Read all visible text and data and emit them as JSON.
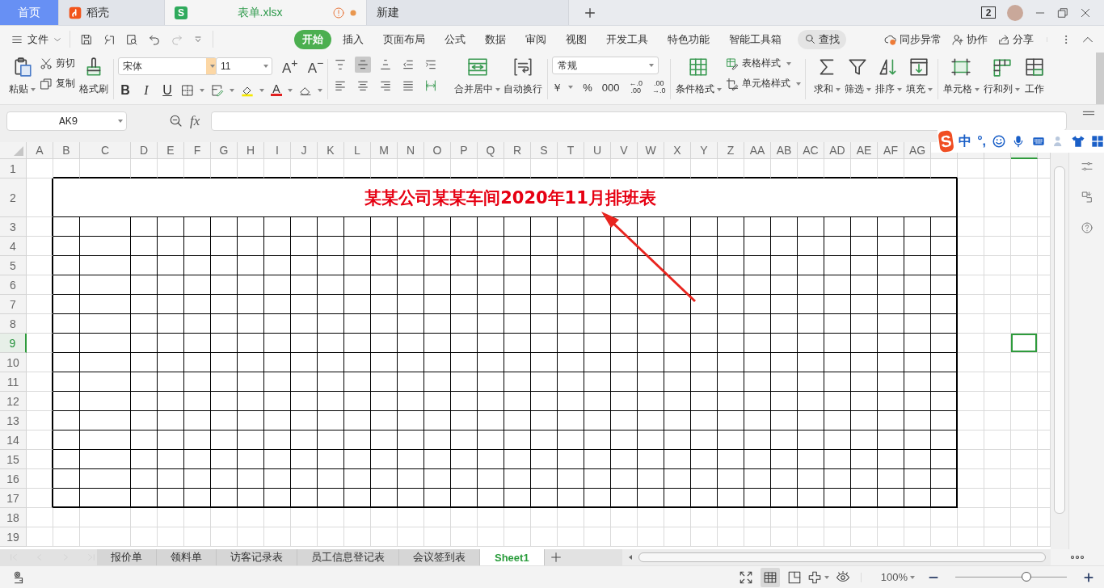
{
  "title_bar": {
    "tabs": [
      {
        "kind": "home",
        "label": "首页",
        "selected": false
      },
      {
        "kind": "app",
        "label": "稻壳",
        "selected": false
      },
      {
        "kind": "doc",
        "badge": "S",
        "label": "表单.xlsx",
        "selected": true,
        "warning": true,
        "modified": true
      },
      {
        "kind": "plain",
        "label": "新建",
        "selected": false
      }
    ],
    "window_count": "2"
  },
  "menu_bar": {
    "file": "文件",
    "tabs": [
      {
        "label": "开始",
        "selected": true
      },
      {
        "label": "插入",
        "selected": false
      },
      {
        "label": "页面布局",
        "selected": false
      },
      {
        "label": "公式",
        "selected": false
      },
      {
        "label": "数据",
        "selected": false
      },
      {
        "label": "审阅",
        "selected": false
      },
      {
        "label": "视图",
        "selected": false
      },
      {
        "label": "开发工具",
        "selected": false
      },
      {
        "label": "特色功能",
        "selected": false
      },
      {
        "label": "智能工具箱",
        "selected": false
      }
    ],
    "search": "查找",
    "actions": [
      {
        "kind": "sync",
        "label": "同步异常"
      },
      {
        "kind": "collab",
        "label": "协作"
      },
      {
        "kind": "share",
        "label": "分享"
      }
    ]
  },
  "ribbon": {
    "clipboard": [
      {
        "kind": "paste",
        "label": "粘贴"
      },
      {
        "kind": "cut",
        "label": "剪切"
      },
      {
        "kind": "copy",
        "label": "复制"
      },
      {
        "kind": "format_painter",
        "label": "格式刷"
      }
    ],
    "font": {
      "name": "宋体",
      "size": "11",
      "size_buttons": [
        "A$^{+}$",
        "A$^{−}$"
      ],
      "styles": [
        {
          "kind": "bold",
          "label": "B"
        },
        {
          "kind": "italic",
          "label": "I"
        },
        {
          "kind": "underline",
          "label": "U"
        }
      ],
      "font_color_label": "A"
    },
    "align_buttons": [
      {
        "kind": "top",
        "selected": false
      },
      {
        "kind": "middle",
        "selected": true
      },
      {
        "kind": "bottom",
        "selected": false
      },
      {
        "kind": "outdent",
        "selected": false
      },
      {
        "kind": "indent",
        "selected": false
      },
      {
        "kind": "left",
        "selected": false
      },
      {
        "kind": "center",
        "selected": false
      },
      {
        "kind": "right",
        "selected": false
      },
      {
        "kind": "justify",
        "selected": false
      },
      {
        "kind": "distributed",
        "selected": false
      }
    ],
    "align": [
      {
        "kind": "merge",
        "label": "合并居中"
      },
      {
        "kind": "wrap",
        "label": "自动换行"
      }
    ],
    "number_format": "常规",
    "number_buttons": [
      {
        "kind": "currency",
        "lines": [
          "￥"
        ]
      },
      {
        "kind": "percent",
        "lines": [
          "%"
        ]
      },
      {
        "kind": "thousands",
        "lines": [
          "000"
        ]
      },
      {
        "kind": "dec_add",
        "lines": [
          "←.0",
          ".00"
        ]
      },
      {
        "kind": "dec_remove",
        "lines": [
          ".00",
          "→.0"
        ]
      }
    ],
    "styles": [
      {
        "kind": "conditional",
        "label": "条件格式"
      },
      {
        "kind": "table_style",
        "label": "表格样式"
      },
      {
        "kind": "cell_style",
        "label": "单元格样式"
      }
    ],
    "editing": [
      {
        "kind": "sum",
        "label": "求和"
      },
      {
        "kind": "filter",
        "label": "筛选"
      },
      {
        "kind": "sort",
        "label": "排序"
      },
      {
        "kind": "fill",
        "label": "填充"
      },
      {
        "kind": "cell",
        "label": "单元格"
      },
      {
        "kind": "rowcol",
        "label": "行和列"
      },
      {
        "kind": "sheet",
        "label": "工作"
      }
    ]
  },
  "formula_bar": {
    "name_box": "AK9",
    "fx": "fx"
  },
  "ime_toolbar": {
    "logo": "S",
    "mode": "中",
    "punctuation": "°,"
  },
  "sheet": {
    "title": "某某公司某某车间2020年11月排班表",
    "columns": [
      {
        "label": "A",
        "selected": false
      },
      {
        "label": "B",
        "selected": false
      },
      {
        "label": "C",
        "selected": false
      },
      {
        "label": "D",
        "selected": false
      },
      {
        "label": "E",
        "selected": false
      },
      {
        "label": "F",
        "selected": false
      },
      {
        "label": "G",
        "selected": false
      },
      {
        "label": "H",
        "selected": false
      },
      {
        "label": "I",
        "selected": false
      },
      {
        "label": "J",
        "selected": false
      },
      {
        "label": "K",
        "selected": false
      },
      {
        "label": "L",
        "selected": false
      },
      {
        "label": "M",
        "selected": false
      },
      {
        "label": "N",
        "selected": false
      },
      {
        "label": "O",
        "selected": false
      },
      {
        "label": "P",
        "selected": false
      },
      {
        "label": "Q",
        "selected": false
      },
      {
        "label": "R",
        "selected": false
      },
      {
        "label": "S",
        "selected": false
      },
      {
        "label": "T",
        "selected": false
      },
      {
        "label": "U",
        "selected": false
      },
      {
        "label": "V",
        "selected": false
      },
      {
        "label": "W",
        "selected": false
      },
      {
        "label": "X",
        "selected": false
      },
      {
        "label": "Y",
        "selected": false
      },
      {
        "label": "Z",
        "selected": false
      },
      {
        "label": "AA",
        "selected": false
      },
      {
        "label": "AB",
        "selected": false
      },
      {
        "label": "AC",
        "selected": false
      },
      {
        "label": "AD",
        "selected": false
      },
      {
        "label": "AE",
        "selected": false
      },
      {
        "label": "AF",
        "selected": false
      },
      {
        "label": "AG",
        "selected": false
      },
      {
        "selected": false
      },
      {
        "selected": false
      },
      {
        "selected": false
      },
      {
        "selected": true
      },
      {
        "selected": false
      }
    ],
    "rows": [
      {
        "label": "1",
        "selected": false
      },
      {
        "label": "2",
        "selected": false
      },
      {
        "label": "3",
        "selected": false
      },
      {
        "label": "4",
        "selected": false
      },
      {
        "label": "5",
        "selected": false
      },
      {
        "label": "6",
        "selected": false
      },
      {
        "label": "7",
        "selected": false
      },
      {
        "label": "8",
        "selected": false
      },
      {
        "label": "9",
        "selected": true
      },
      {
        "label": "10",
        "selected": false
      },
      {
        "label": "11",
        "selected": false
      },
      {
        "label": "12",
        "selected": false
      },
      {
        "label": "13",
        "selected": false
      },
      {
        "label": "14",
        "selected": false
      },
      {
        "label": "15",
        "selected": false
      },
      {
        "label": "16",
        "selected": false
      },
      {
        "label": "17",
        "selected": false
      },
      {
        "label": "18",
        "selected": false
      },
      {
        "label": "19",
        "selected": false
      }
    ]
  },
  "sheet_tabs": [
    {
      "label": "报价单",
      "selected": false
    },
    {
      "label": "领料单",
      "selected": false
    },
    {
      "label": "访客记录表",
      "selected": false
    },
    {
      "label": "员工信息登记表",
      "selected": false
    },
    {
      "label": "会议签到表",
      "selected": false
    },
    {
      "label": "Sheet1",
      "selected": true
    }
  ],
  "status_bar": {
    "views": [
      {
        "kind": "fullscreen",
        "selected": false
      },
      {
        "kind": "normal",
        "selected": true
      },
      {
        "kind": "page",
        "selected": false
      },
      {
        "kind": "layout",
        "selected": false
      },
      {
        "kind": "eye",
        "selected": false
      }
    ],
    "zoom": {
      "reading": "100%",
      "level": 0.64
    }
  }
}
